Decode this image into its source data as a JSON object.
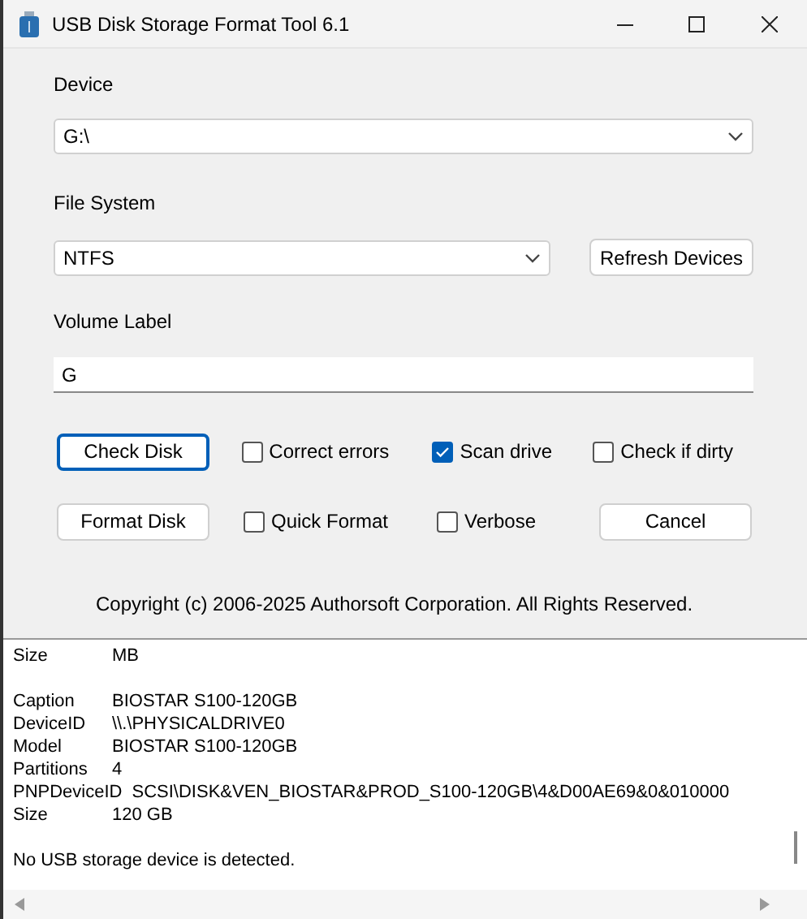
{
  "window": {
    "title": "USB Disk Storage Format Tool 6.1"
  },
  "device": {
    "label": "Device",
    "value": "G:\\"
  },
  "file_system": {
    "label": "File System",
    "value": "NTFS"
  },
  "refresh_button": "Refresh Devices",
  "volume_label": {
    "label": "Volume Label",
    "value": "G"
  },
  "rows": [
    {
      "button": {
        "label": "Check Disk",
        "focused": true
      },
      "options": [
        {
          "label": "Correct errors",
          "checked": false
        },
        {
          "label": "Scan drive",
          "checked": true
        },
        {
          "label": "Check if dirty",
          "checked": false
        }
      ]
    },
    {
      "button": {
        "label": "Format Disk",
        "focused": false
      },
      "options": [
        {
          "label": "Quick Format",
          "checked": false
        },
        {
          "label": "Verbose",
          "checked": false
        }
      ],
      "end_button": "Cancel"
    }
  ],
  "copyright": "Copyright (c) 2006-2025 Authorsoft Corporation. All Rights Reserved.",
  "log": [
    {
      "kind": "pair",
      "key": "Size",
      "value": "MB"
    },
    {
      "kind": "gap"
    },
    {
      "kind": "pair",
      "key": "Caption",
      "value": "BIOSTAR S100-120GB"
    },
    {
      "kind": "pair",
      "key": "DeviceID",
      "value": "\\\\.\\PHYSICALDRIVE0"
    },
    {
      "kind": "pair",
      "key": "Model",
      "value": "BIOSTAR S100-120GB"
    },
    {
      "kind": "pair",
      "key": "Partitions",
      "value": "4"
    },
    {
      "kind": "pair",
      "key": "PNPDeviceID",
      "value": "SCSI\\DISK&VEN_BIOSTAR&PROD_S100-120GB\\4&D00AE69&0&010000"
    },
    {
      "kind": "pair",
      "key": "Size",
      "value": "120 GB"
    },
    {
      "kind": "gap"
    },
    {
      "kind": "text",
      "text": "No USB storage device is detected."
    }
  ]
}
